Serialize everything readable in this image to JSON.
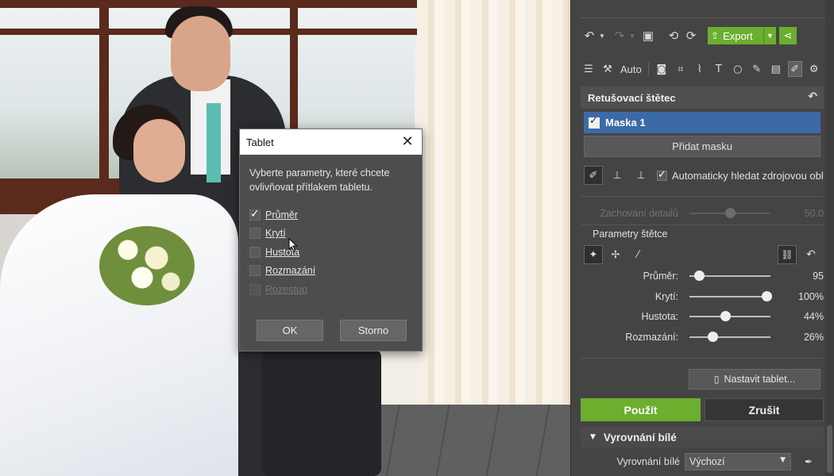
{
  "dialog": {
    "title": "Tablet",
    "description": "Vyberte parametry, které chcete ovlivňovat přítlakem tabletu.",
    "options": [
      {
        "label": "Průměr",
        "checked": true,
        "enabled": true
      },
      {
        "label": "Krytí",
        "checked": false,
        "enabled": true
      },
      {
        "label": "Hustota",
        "checked": false,
        "enabled": true
      },
      {
        "label": "Rozmazání",
        "checked": false,
        "enabled": true
      },
      {
        "label": "Rozestup",
        "checked": false,
        "enabled": false
      }
    ],
    "ok_label": "OK",
    "cancel_label": "Storno"
  },
  "toolbar": {
    "export_label": "Export"
  },
  "tools_row": {
    "auto_label": "Auto"
  },
  "section": {
    "title": "Retušovací štětec",
    "mask_label": "Maska 1",
    "add_mask_label": "Přidat masku",
    "auto_source_label": "Automaticky hledat zdrojovou obl",
    "detail": {
      "label": "Zachování detailů",
      "value": "50.0",
      "level": 0.5
    },
    "brush_params_label": "Parametry štětce",
    "sliders": [
      {
        "label": "Průměr:",
        "value": "95",
        "level": 0.12
      },
      {
        "label": "Krytí:",
        "value": "100%",
        "level": 0.95
      },
      {
        "label": "Hustota:",
        "value": "44%",
        "level": 0.44
      },
      {
        "label": "Rozmazání:",
        "value": "26%",
        "level": 0.28
      }
    ],
    "tablet_button_label": "Nastavit tablet...",
    "apply_label": "Použít",
    "cancel_label": "Zrušit"
  },
  "white_balance": {
    "title": "Vyrovnání bílé",
    "label": "Vyrovnání bílé",
    "selected": "Výchozí"
  },
  "colors": {
    "accent_green": "#6cae2e",
    "selection_blue": "#3c6aa8",
    "panel_bg": "#444444"
  }
}
